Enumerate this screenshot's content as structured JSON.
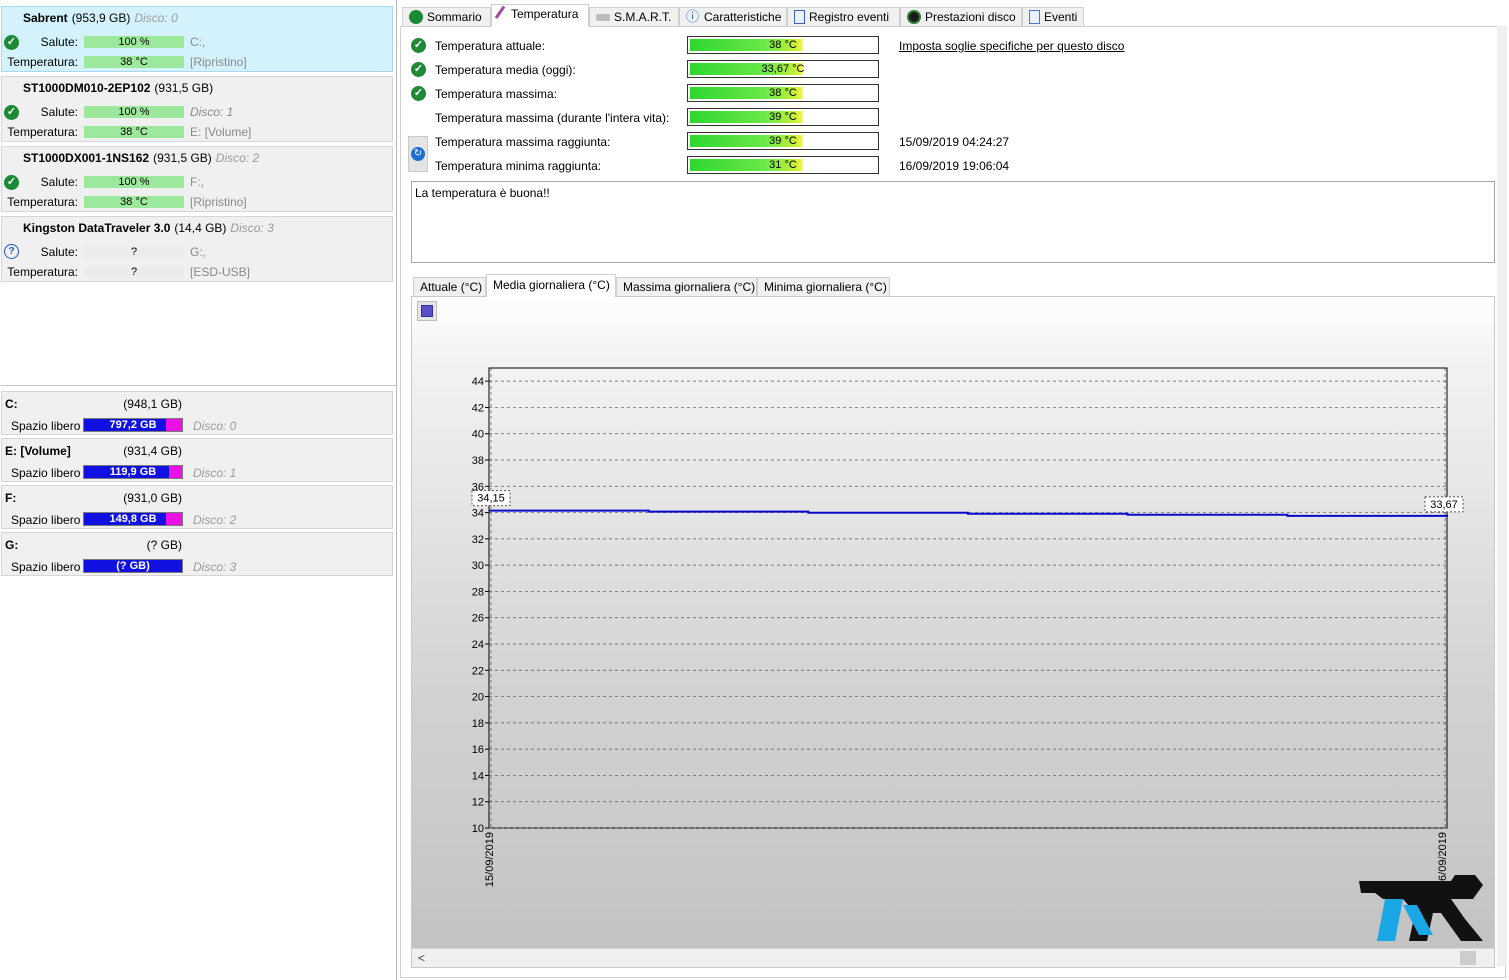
{
  "disks": [
    {
      "name": "Sabrent",
      "size": "(953,9 GB)",
      "disk_no": "Disco: 0",
      "health_label": "Salute:",
      "health_value": "100 %",
      "temp_label": "Temperatura:",
      "temp_value": "38 °C",
      "vol1": "C:,",
      "vol2": "[Ripristino]",
      "status": "ok"
    },
    {
      "name": "ST1000DM010-2EP102",
      "size": "(931,5 GB)",
      "disk_no": "",
      "health_label": "Salute:",
      "health_value": "100 %",
      "temp_label": "Temperatura:",
      "temp_value": "38 °C",
      "vol1": "Disco: 1",
      "vol2": "E: [Volume]",
      "status": "ok"
    },
    {
      "name": "ST1000DX001-1NS162",
      "size": "(931,5 GB)",
      "disk_no": "Disco: 2",
      "health_label": "Salute:",
      "health_value": "100 %",
      "temp_label": "Temperatura:",
      "temp_value": "38 °C",
      "vol1": "F:,",
      "vol2": "[Ripristino]",
      "status": "ok"
    },
    {
      "name": "Kingston DataTraveler 3.0",
      "size": "(14,4 GB)",
      "disk_no": "Disco: 3",
      "health_label": "Salute:",
      "health_value": "?",
      "temp_label": "Temperatura:",
      "temp_value": "?",
      "vol1": "G:,",
      "vol2": "[ESD-USB]",
      "status": "unknown"
    }
  ],
  "volumes": [
    {
      "name": "C:",
      "size": "(948,1 GB)",
      "free_label": "Spazio libero",
      "free_value": "797,2 GB",
      "disk": "Disco: 0",
      "free_fraction": 0.84
    },
    {
      "name": "E: [Volume]",
      "size": "(931,4 GB)",
      "free_label": "Spazio libero",
      "free_value": "119,9 GB",
      "disk": "Disco: 1",
      "free_fraction": 0.87
    },
    {
      "name": "F:",
      "size": "(931,0 GB)",
      "free_label": "Spazio libero",
      "free_value": "149,8 GB",
      "disk": "Disco: 2",
      "free_fraction": 0.84
    },
    {
      "name": "G:",
      "size": "(? GB)",
      "free_label": "Spazio libero",
      "free_value": "(? GB)",
      "disk": "Disco: 3",
      "free_fraction": 1.0
    }
  ],
  "tabs": [
    {
      "label": "Sommario",
      "icon": "check-icon"
    },
    {
      "label": "Temperatura",
      "icon": "thermometer-icon"
    },
    {
      "label": "S.M.A.R.T.",
      "icon": "hdd-icon"
    },
    {
      "label": "Caratteristiche",
      "icon": "info-icon"
    },
    {
      "label": "Registro eventi",
      "icon": "log-icon"
    },
    {
      "label": "Prestazioni disco",
      "icon": "gauge-icon"
    },
    {
      "label": "Eventi",
      "icon": "events-icon"
    }
  ],
  "temps": [
    {
      "label": "Temperatura attuale:",
      "value": "38 °C",
      "icon": true
    },
    {
      "label": "Temperatura media (oggi):",
      "value": "33,67 °C",
      "icon": true
    },
    {
      "label": "Temperatura massima:",
      "value": "38 °C",
      "icon": true
    },
    {
      "label": "Temperatura massima (durante l'intera vita):",
      "value": "39 °C",
      "icon": false
    },
    {
      "label": "Temperatura massima raggiunta:",
      "value": "39 °C",
      "icon": false,
      "date": "15/09/2019 04:24:27"
    },
    {
      "label": "Temperatura minima raggiunta:",
      "value": "31 °C",
      "icon": false,
      "date": "16/09/2019 19:06:04"
    }
  ],
  "threshold_link": "Imposta soglie specifiche per questo disco",
  "message": "La temperatura è buona!!",
  "subtabs": [
    "Attuale (°C)",
    "Media giornaliera (°C)",
    "Massima giornaliera (°C)",
    "Minima giornaliera (°C)"
  ],
  "chart_data": {
    "type": "line",
    "x": [
      "15/09/2019",
      "16/09/2019"
    ],
    "xtick_labels": [
      "15/09/2019",
      "16/09/2019"
    ],
    "values": [
      34.15,
      33.67
    ],
    "point_labels": [
      "34,15",
      "33,67"
    ],
    "ylim": [
      10,
      45
    ],
    "yticks": [
      10,
      12,
      14,
      16,
      18,
      20,
      22,
      24,
      26,
      28,
      30,
      32,
      34,
      36,
      38,
      40,
      42,
      44
    ],
    "grid": true,
    "line_color": "#0a0acc"
  },
  "colors": {
    "selected_disk_bg": "#d3f2fc",
    "health_bar": "#9ce89c",
    "free_space": "#1010e0",
    "used_space": "#ea10e6"
  }
}
